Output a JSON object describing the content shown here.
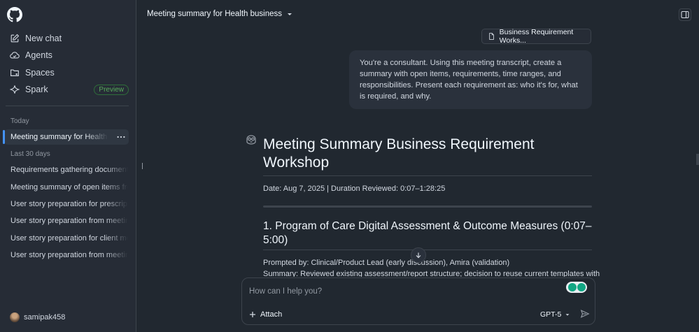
{
  "sidebar": {
    "nav": [
      {
        "label": "New chat",
        "icon": "new-chat-icon"
      },
      {
        "label": "Agents",
        "icon": "agents-icon"
      },
      {
        "label": "Spaces",
        "icon": "spaces-icon"
      },
      {
        "label": "Spark",
        "icon": "spark-icon",
        "badge": "Preview"
      }
    ],
    "today_label": "Today",
    "active_chat": "Meeting summary for Health business",
    "last30_label": "Last 30 days",
    "chats": [
      "Requirements gathering document for client",
      "Meeting summary of open items from",
      "User story preparation for prescription tool",
      "User story preparation from meeting transcript",
      "User story preparation for client meeting",
      "User story preparation from meeting transcript"
    ],
    "user": "samipak458"
  },
  "header": {
    "title": "Meeting summary for Health business"
  },
  "attachment": {
    "label": "Business Requirement Works..."
  },
  "user_message": "You're a consultant. Using this meeting transcript, create a summary with open items, requirements, time ranges, and responsibilities. Present each requirement as: who it's for, what is required, and why.",
  "response": {
    "title": "Meeting Summary Business Requirement Workshop",
    "meta": "Date: Aug 7, 2025 | Duration Reviewed: 0:07–1:28:25",
    "section1_title": "1. Program of Care Digital Assessment & Outcome Measures (0:07–5:00)",
    "prompted_by": "Prompted by: Clinical/Product Lead (early discussion), Amira (validation)",
    "summary": "Summary: Reviewed existing assessment/report structure; decision to reuse current templates with"
  },
  "composer": {
    "placeholder": "How can I help you?",
    "attach_label": "Attach",
    "model_label": "GPT-5"
  },
  "colors": {
    "background": "#212830",
    "sidebar": "#262c36",
    "accent": "#4493f8",
    "preview_badge": "#57ab5a"
  }
}
